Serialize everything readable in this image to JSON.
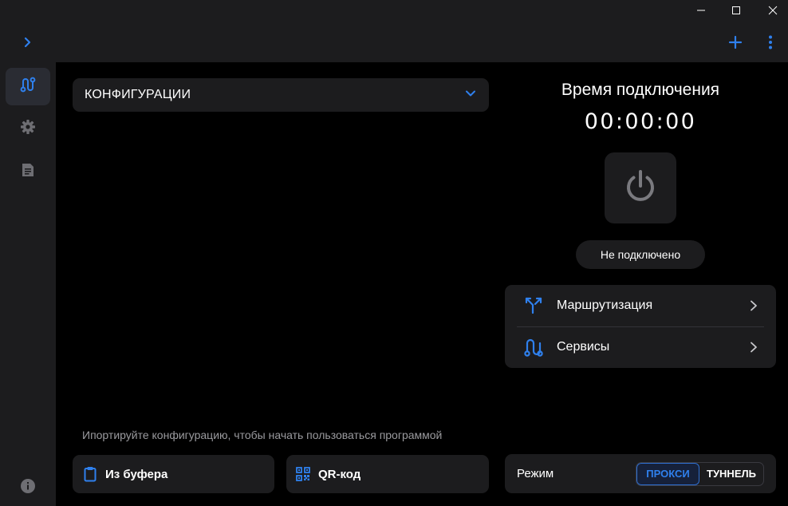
{
  "app": {
    "icons": {
      "minimize": "minimize-icon",
      "maximize": "maximize-icon",
      "close": "close-icon",
      "expand": "chevron-right-icon",
      "add": "plus-icon",
      "more": "more-vertical-icon"
    },
    "accent_color": "#2f80ed"
  },
  "sidebar": {
    "items": [
      {
        "icon": "route-icon",
        "active": true
      },
      {
        "icon": "gear-icon",
        "active": false
      },
      {
        "icon": "document-icon",
        "active": false
      }
    ],
    "footer_icon": "info-icon"
  },
  "configs": {
    "dropdown_label": "КОНФИГУРАЦИИ",
    "empty_hint": "Ипортируйте конфигурацию, чтобы начать пользоваться программой",
    "import_buttons": [
      {
        "label": "Из буфера",
        "icon": "clipboard-icon"
      },
      {
        "label": "QR-код",
        "icon": "qr-code-icon"
      }
    ]
  },
  "connection": {
    "title": "Время подключения",
    "timer": "00:00:00",
    "status": "Не подключено",
    "power_icon": "power-icon"
  },
  "menu": {
    "items": [
      {
        "label": "Маршрутизация",
        "icon": "split-route-icon"
      },
      {
        "label": "Сервисы",
        "icon": "services-route-icon"
      }
    ]
  },
  "mode": {
    "label": "Режим",
    "options": [
      "ПРОКСИ",
      "ТУННЕЛЬ"
    ],
    "selected": "ПРОКСИ"
  }
}
